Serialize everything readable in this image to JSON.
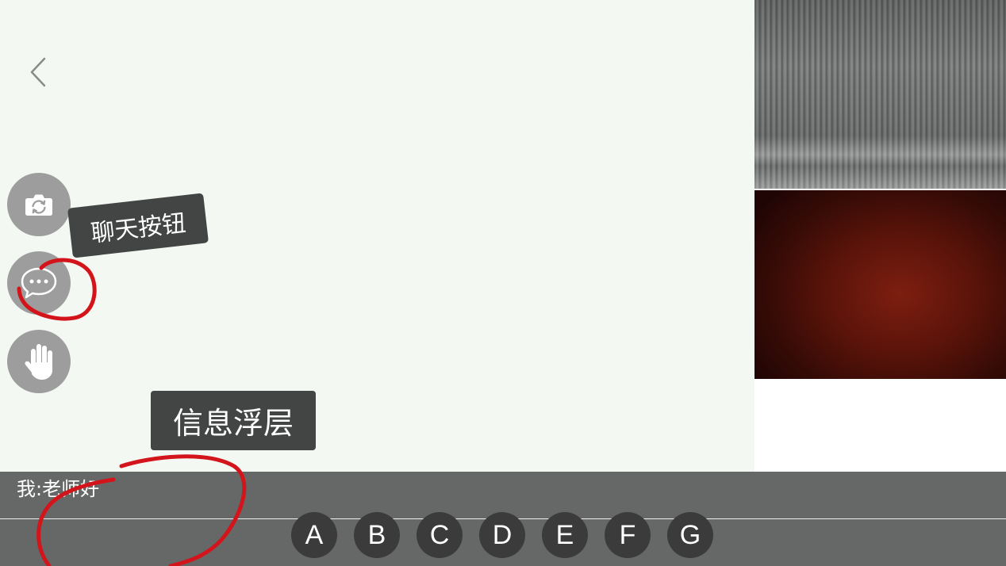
{
  "header": {
    "back_button": {
      "icon": "chevron-left-icon"
    }
  },
  "side_toolbar": {
    "buttons": [
      {
        "icon": "camera-switch-icon"
      },
      {
        "icon": "chat-bubble-icon"
      },
      {
        "icon": "raise-hand-icon"
      }
    ]
  },
  "tooltips": {
    "chat_button": "聊天按钮",
    "message_overlay": "信息浮层"
  },
  "chat": {
    "messages": [
      {
        "text": "我:老师好"
      }
    ]
  },
  "answer_options": [
    "A",
    "B",
    "C",
    "D",
    "E",
    "F",
    "G"
  ],
  "colors": {
    "main_bg": "#f4f8f3",
    "bar_bg": "#666867",
    "tooltip_bg": "#434544",
    "side_button_bg": "#9c9d9c",
    "answer_button_bg": "#3a3b3a",
    "annotation": "#d3141a"
  }
}
